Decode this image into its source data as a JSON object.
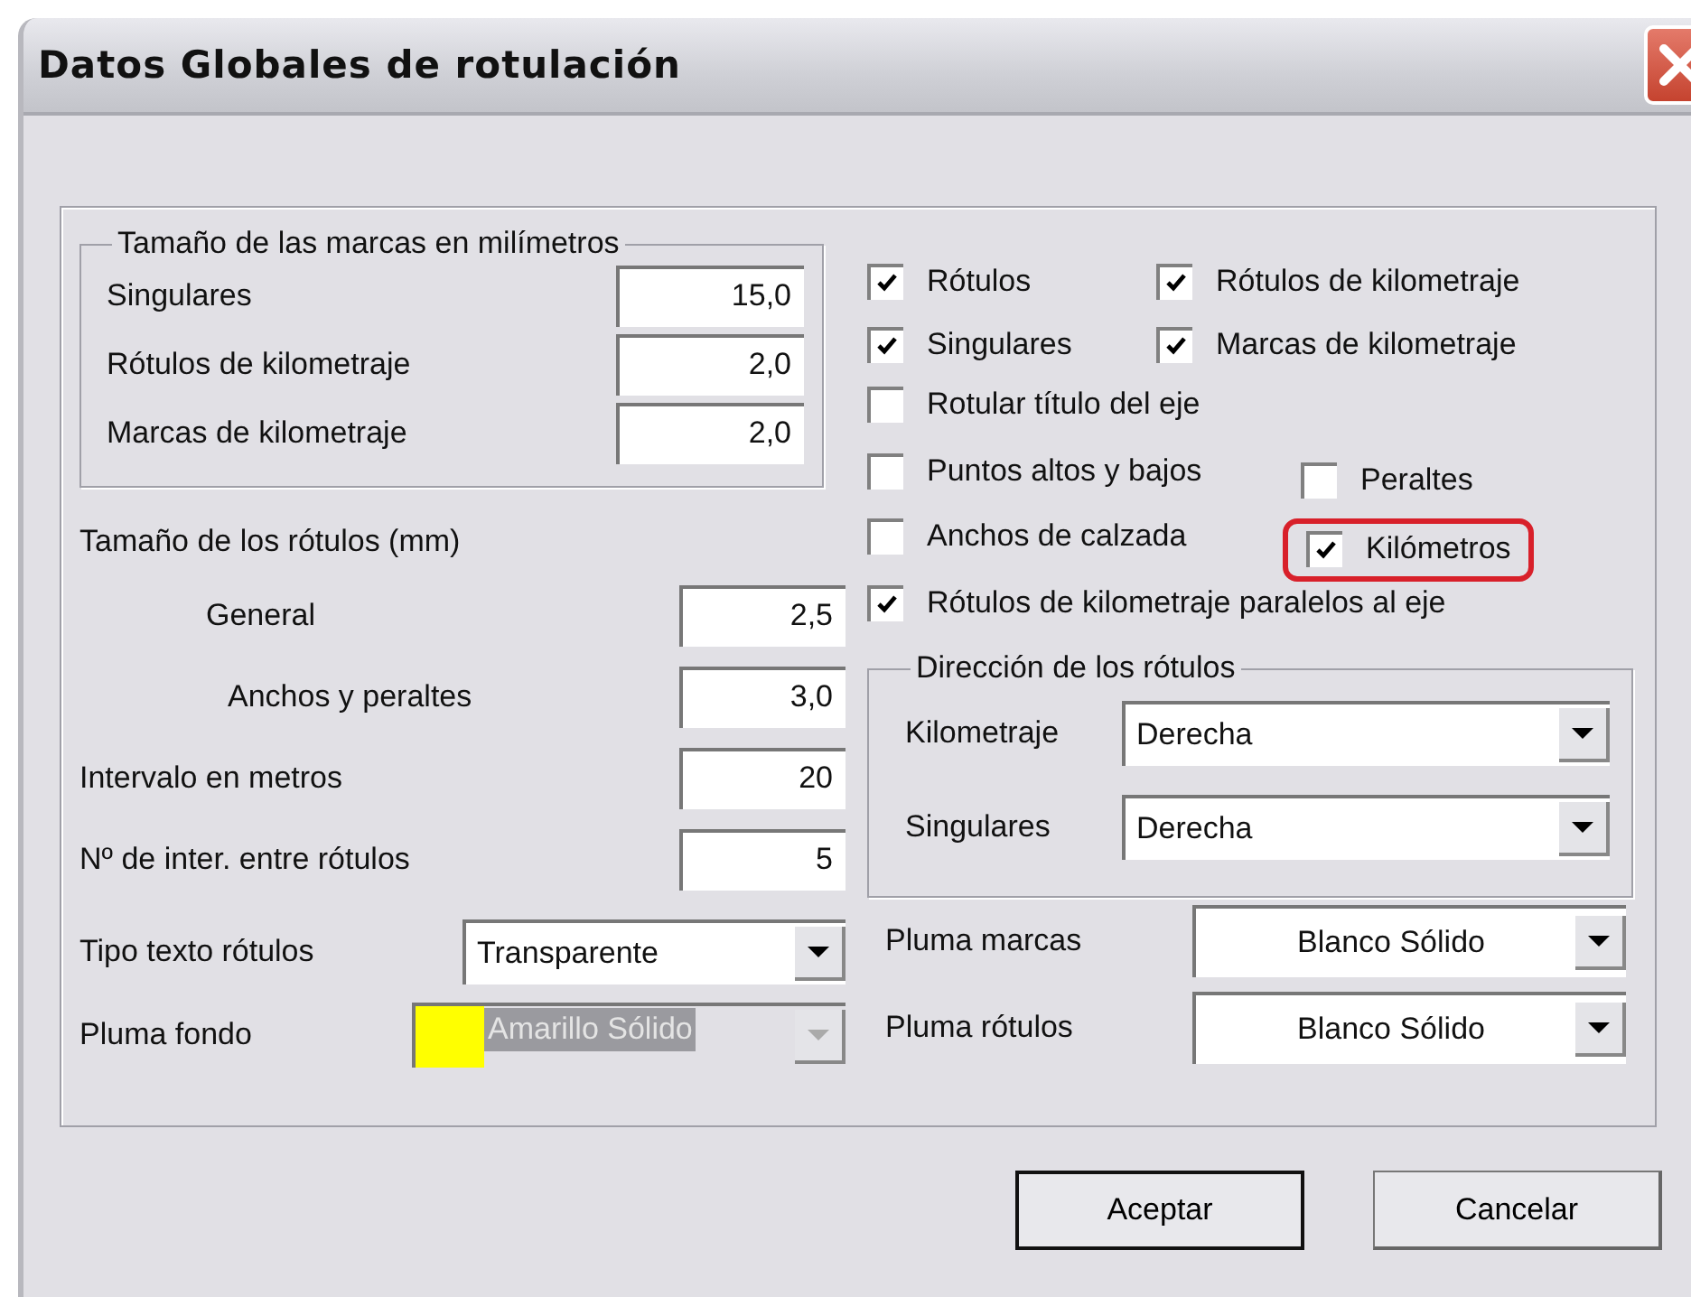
{
  "window": {
    "title": "Datos Globales de rotulación"
  },
  "marks_group": {
    "legend": "Tamaño de las marcas en milímetros",
    "fields": [
      {
        "label": "Singulares",
        "value": "15,0"
      },
      {
        "label": "Rótulos de kilometraje",
        "value": "2,0"
      },
      {
        "label": "Marcas de kilometraje",
        "value": "2,0"
      }
    ]
  },
  "sizes_heading": "Tamaño de los rótulos (mm)",
  "size_fields": [
    {
      "kind": "sub",
      "label": "General",
      "value": "2,5"
    },
    {
      "kind": "sub",
      "label": "Anchos y peraltes",
      "value": "3,0"
    },
    {
      "kind": "main",
      "label": "Intervalo en metros",
      "value": "20"
    },
    {
      "kind": "main",
      "label": "Nº de inter. entre rótulos",
      "value": "5"
    }
  ],
  "text_type": {
    "label": "Tipo texto rótulos",
    "value": "Transparente"
  },
  "background_pen": {
    "label": "Pluma fondo",
    "value": "Amarillo Sólido",
    "color": "#ffff00",
    "disabled": true
  },
  "checkbox_rows": [
    [
      {
        "label": "Rótulos",
        "checked": true,
        "highlighted": false
      },
      {
        "label": "Rótulos de kilometraje",
        "checked": true,
        "highlighted": false
      }
    ],
    [
      {
        "label": "Singulares",
        "checked": true,
        "highlighted": false
      },
      {
        "label": "Marcas de kilometraje",
        "checked": true,
        "highlighted": false
      }
    ],
    [
      {
        "label": "Rotular título del eje",
        "checked": false,
        "highlighted": false
      }
    ],
    [
      {
        "label": "Puntos altos y bajos",
        "checked": false,
        "highlighted": false
      },
      {
        "label": "Peraltes",
        "checked": false,
        "highlighted": false
      }
    ],
    [
      {
        "label": "Anchos de calzada",
        "checked": false,
        "highlighted": false
      },
      {
        "label": "Kilómetros",
        "checked": true,
        "highlighted": true
      }
    ],
    [
      {
        "label": "Rótulos de kilometraje paralelos al eje",
        "checked": true,
        "highlighted": false
      }
    ]
  ],
  "direction_group": {
    "legend": "Dirección de los rótulos",
    "selects": [
      {
        "label": "Kilometraje",
        "value": "Derecha"
      },
      {
        "label": "Singulares",
        "value": "Derecha"
      }
    ]
  },
  "pens": [
    {
      "label": "Pluma marcas",
      "value": "Blanco Sólido"
    },
    {
      "label": "Pluma rótulos",
      "value": "Blanco Sólido"
    }
  ],
  "buttons": [
    {
      "label": "Aceptar",
      "default": true
    },
    {
      "label": "Cancelar",
      "default": false
    }
  ]
}
